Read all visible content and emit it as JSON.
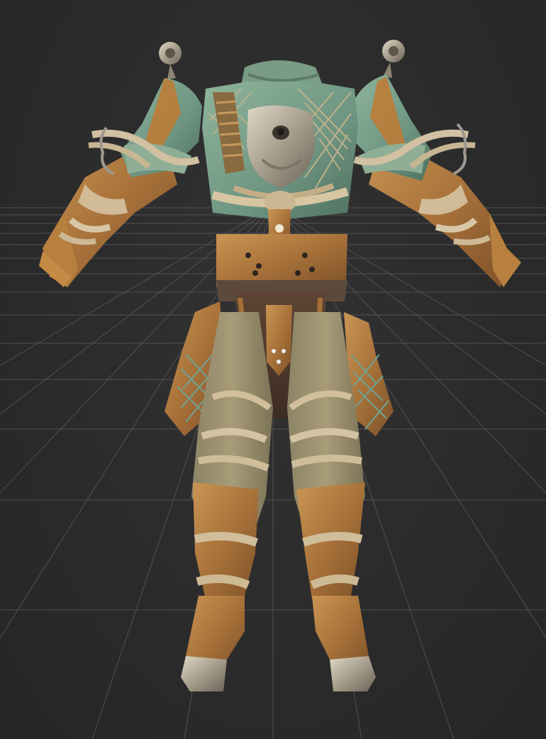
{
  "scene": {
    "background_color": "#2b2b2c",
    "grid_color": "#5a5a5c",
    "grid_visible": true,
    "subject": "armor-model-3d-preview"
  },
  "palette": {
    "verdigris": "#6f9a86",
    "leather": "#b07a3f",
    "dark_leather": "#6b4628",
    "rope": "#cdbba0",
    "steel": "#b9b2a4",
    "rust": "#8f5a2c"
  }
}
